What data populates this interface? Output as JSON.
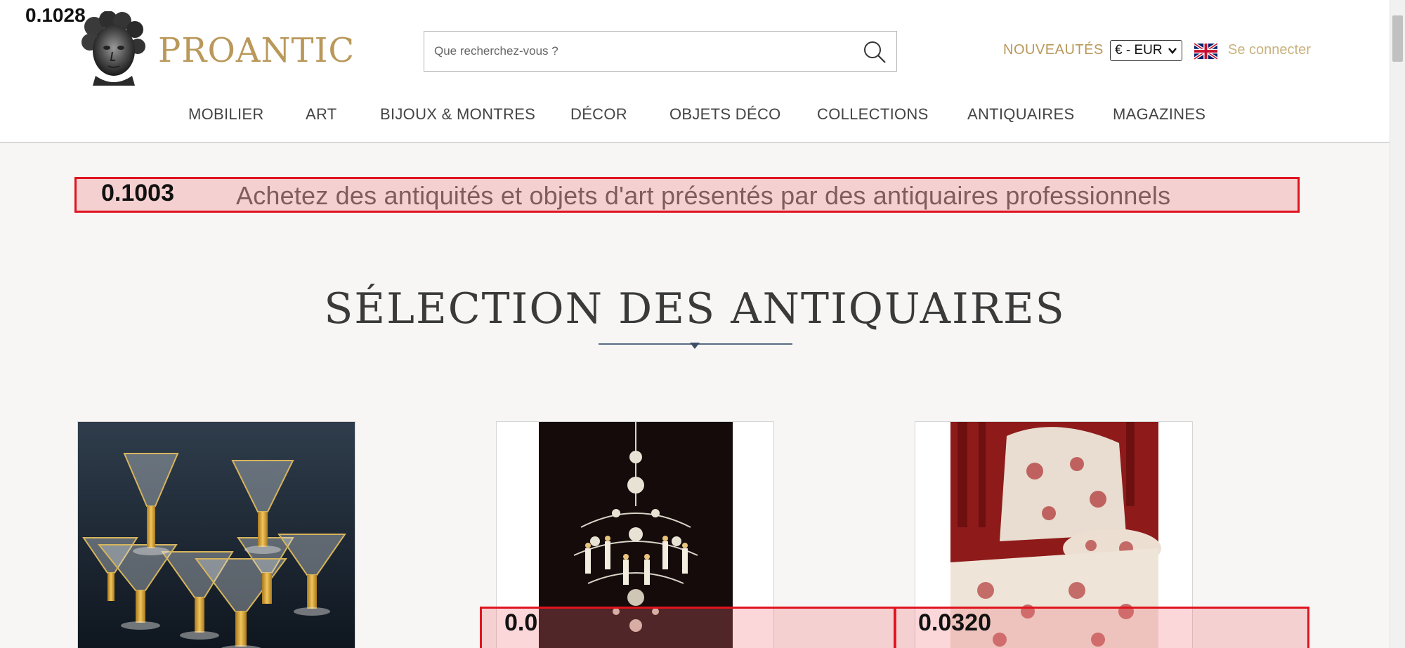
{
  "overlay": {
    "top_left_score": "0.1028",
    "tagline_score": "0.1003",
    "card2_score": "0.0",
    "card3_score": "0.0320"
  },
  "header": {
    "brand": "PROANTIC",
    "search_placeholder": "Que recherchez-vous ?",
    "nouveautes": "NOUVEAUTÉS",
    "currency": "€ - EUR",
    "login": "Se connecter"
  },
  "nav": {
    "items": [
      "MOBILIER",
      "ART",
      "BIJOUX & MONTRES",
      "DÉCOR",
      "OBJETS DÉCO",
      "COLLECTIONS",
      "ANTIQUAIRES",
      "MAGAZINES"
    ]
  },
  "main": {
    "tagline": "Achetez des antiquités et objets d'art présentés par des antiquaires professionnels",
    "section_title": "SÉLECTION DES ANTIQUAIRES"
  },
  "colors": {
    "brand_gold": "#b9985a",
    "overlay_red": "#e0141e",
    "divider_blue": "#5a6b86"
  },
  "icons": {
    "search": "search-icon",
    "flag": "uk-flag-icon",
    "logo": "logo-bust-icon"
  }
}
